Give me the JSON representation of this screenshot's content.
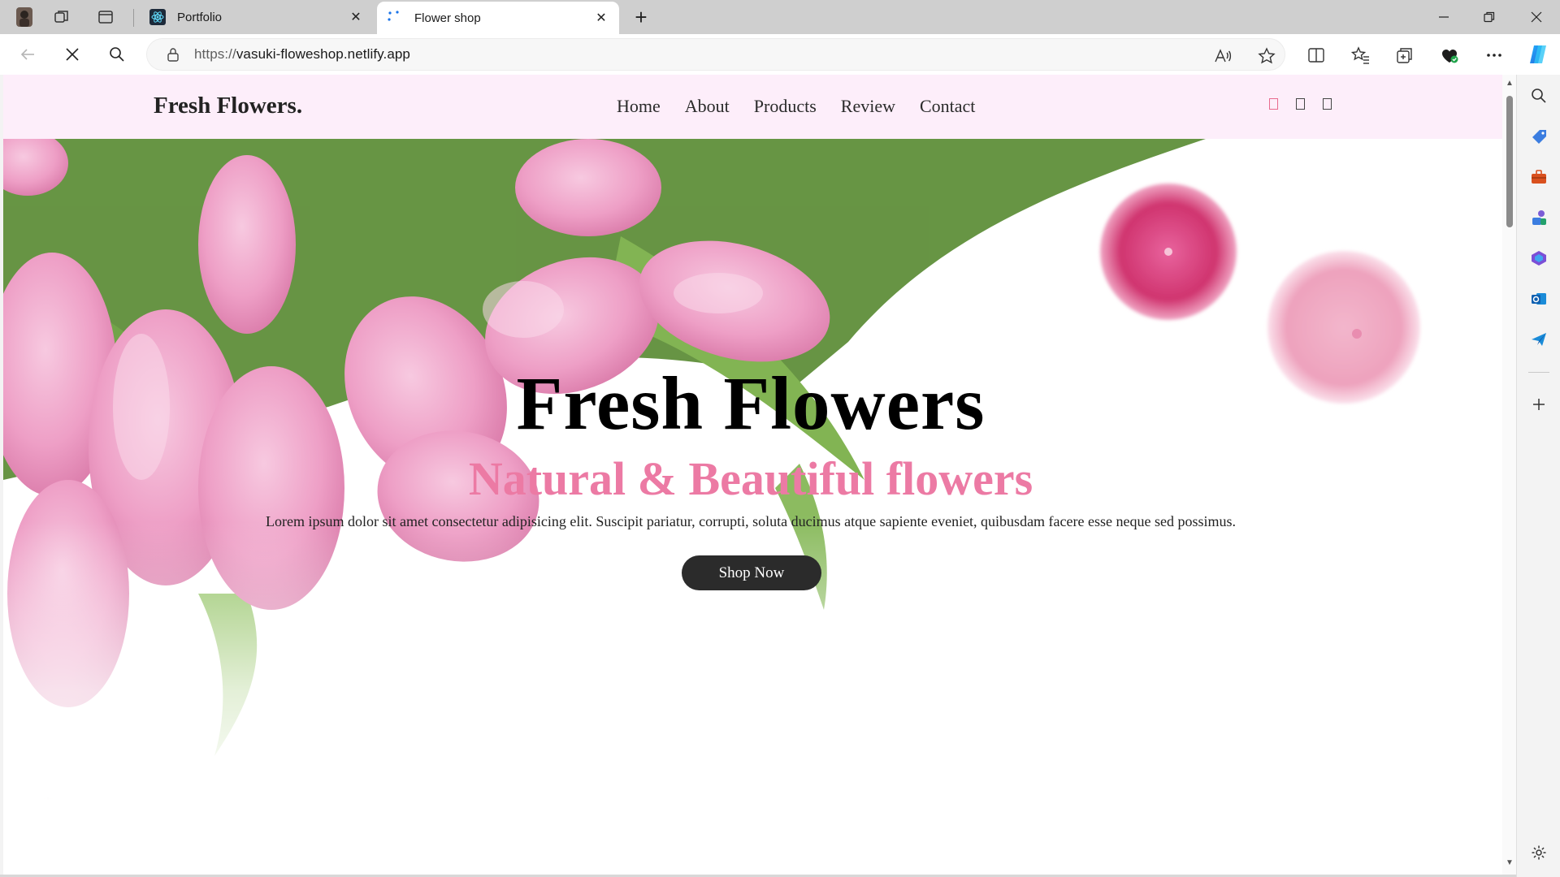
{
  "browser": {
    "tabs": [
      {
        "title": "Portfolio",
        "favicon": "react-atom-icon",
        "active": false
      },
      {
        "title": "Flower shop",
        "favicon": "loading-dots-icon",
        "active": true
      }
    ],
    "address": {
      "scheme": "https://",
      "host": "vasuki-floweshop.netlify.app"
    },
    "colors": {
      "tabbar": "#cfcfcf",
      "active_tab": "#ffffff"
    }
  },
  "site": {
    "logo": "Fresh Flowers.",
    "nav": [
      "Home",
      "About",
      "Products",
      "Review",
      "Contact"
    ],
    "header_bg": "#fdeefa",
    "header_icons": [
      "heart-icon",
      "cart-icon",
      "user-icon"
    ]
  },
  "hero": {
    "title": "Fresh Flowers",
    "subtitle": "Natural & Beautiful flowers",
    "description": "Lorem ipsum dolor sit amet consectetur adipisicing elit. Suscipit pariatur, corrupti, soluta ducimus atque sapiente eveniet, quibusdam facere esse neque sed possimus.",
    "button": "Shop Now",
    "accent": "#ec7aa4"
  }
}
